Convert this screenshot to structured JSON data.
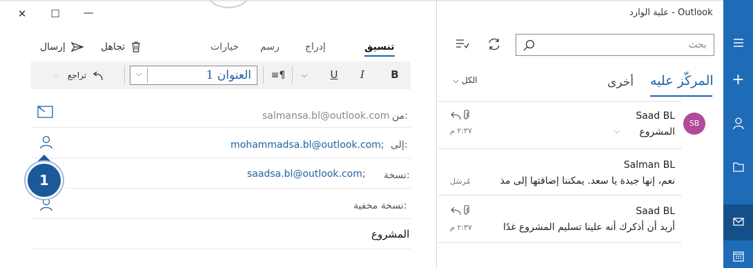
{
  "window": {
    "close_glyph": "✕",
    "maximize_glyph": "☐",
    "minimize_glyph": "—"
  },
  "compose": {
    "commands": {
      "send_label": "إرسال",
      "discard_label": "تجاهل"
    },
    "tabs": [
      {
        "label": "تنسيق",
        "active": true
      },
      {
        "label": "إدراج",
        "active": false
      },
      {
        "label": "رسم",
        "active": false
      },
      {
        "label": "خيارات",
        "active": false
      }
    ],
    "format": {
      "bold": "B",
      "italic": "I",
      "underline": "U",
      "paragraph": "≡¶",
      "style_value": "العنوان 1",
      "undo_label": "تراجع"
    },
    "fields": {
      "from_label": "من:",
      "from_value": "salmansa.bl@outlook.com",
      "to_label": "إلى:",
      "to_value": "mohammadsa.bl@outlook.com;",
      "cc_label": "نسخة:",
      "cc_value": "saadsa.bl@outlook.com;",
      "bcc_label": "نسخة مخفية:",
      "subject_value": "المشروع"
    },
    "callout_number": "1"
  },
  "mail": {
    "app_title": "علبة الوارد - Outlook",
    "search_placeholder": "بحث",
    "tabs": {
      "focused": "المركّز عليه",
      "other": "أخرى",
      "filter": "الكل"
    },
    "messages": [
      {
        "sender": "Saad BL",
        "avatar": "SB",
        "subject": "المشروع",
        "preview": "",
        "time": "٢:٣٧ م"
      },
      {
        "sender": "Salman BL",
        "subject": "",
        "preview": "نعم، إنها جيدة يا سعد. يمكننا إضافتها إلى مذ",
        "meta": "مُرسَل"
      },
      {
        "sender": "Saad BL",
        "subject": "",
        "preview": "أريد أن أذكرك أنه علينا تسليم المشروع غدًا",
        "time": "٢:٣٧ م"
      }
    ]
  },
  "colors": {
    "accent": "#1a64b5",
    "rail": "#1e6bb8",
    "avatar": "#b24a9b"
  }
}
